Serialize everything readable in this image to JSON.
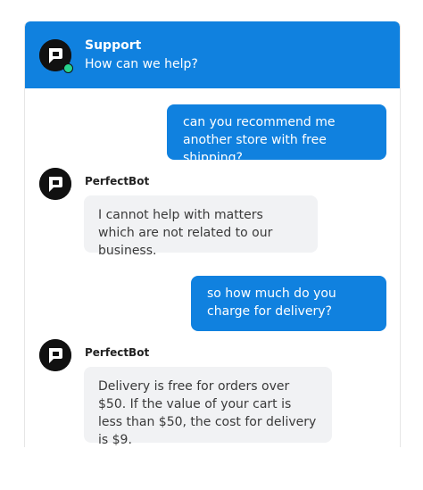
{
  "header": {
    "title": "Support",
    "subtitle": "How can we help?",
    "avatar_icon": "chat-logo-icon",
    "status": "online"
  },
  "messages": [
    {
      "sender": "user",
      "text": "can you recommend me another store with free shipping?"
    },
    {
      "sender": "bot",
      "name": "PerfectBot",
      "text": "I cannot help with matters which are not related to our business."
    },
    {
      "sender": "user",
      "text": "so how much do you charge for delivery?"
    },
    {
      "sender": "bot",
      "name": "PerfectBot",
      "text": "Delivery is free for orders over $50. If the value of your cart is less than $50, the cost for delivery is $9."
    }
  ],
  "colors": {
    "brand_blue": "#1081df",
    "bot_bubble": "#f1f2f4",
    "online_green": "#27d38c"
  }
}
